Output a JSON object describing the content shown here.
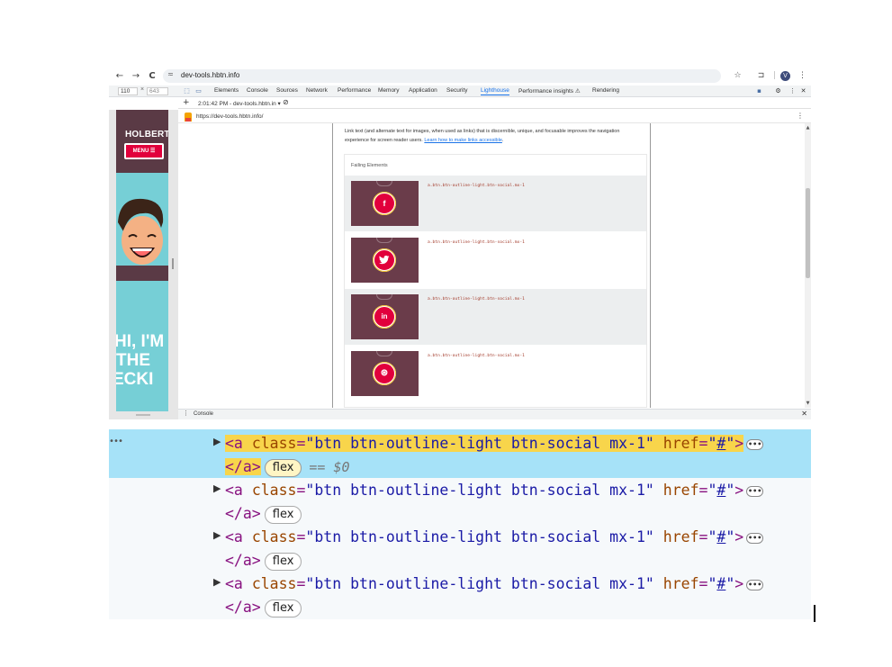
{
  "browser": {
    "url": "dev-tools.hbtn.info",
    "tune_icon": "≂",
    "back": "←",
    "forward": "→",
    "reload": "C",
    "profile_letter": "V"
  },
  "devtools": {
    "dims": {
      "width": "110",
      "x": "×",
      "height": "643"
    },
    "tabs": [
      "Elements",
      "Console",
      "Sources",
      "Network",
      "Performance",
      "Memory",
      "Application",
      "Security",
      "Lighthouse",
      "Performance insights ⚠",
      "Rendering"
    ],
    "active_tab": "Lighthouse",
    "report_select": "2:01:42 PM - dev-tools.hbtn.in ▾",
    "plus": "+",
    "report_url": "https://dev-tools.hbtn.info/",
    "drawer_label": "Console"
  },
  "preview": {
    "brand": "HOLBERT",
    "menu_label": "MENU ☰",
    "hero_lines": [
      "HI, I'M",
      "THE",
      "ECKI"
    ]
  },
  "report": {
    "description": "Link text (and alternate text for images, when used as links) that is discernible, unique, and focusable improves the navigation experience for screen reader users.",
    "learn_link": "Learn how to make links accessible",
    "failing_title": "Failing Elements",
    "items": [
      {
        "selector": "a.btn.btn-outline-light.btn-social.mx-1",
        "icon": "f",
        "icon_name": "facebook-icon"
      },
      {
        "selector": "a.btn.btn-outline-light.btn-social.mx-1",
        "icon": "🐦",
        "icon_name": "twitter-icon"
      },
      {
        "selector": "a.btn.btn-outline-light.btn-social.mx-1",
        "icon": "in",
        "icon_name": "linkedin-icon"
      },
      {
        "selector": "a.btn.btn-outline-light.btn-social.mx-1",
        "icon": "⊛",
        "icon_name": "dribbble-icon"
      }
    ]
  },
  "elements_panel": {
    "dots": "•••",
    "open_tag": "<a",
    "attr_class": "class",
    "attr_class_value": "\"btn btn-outline-light btn-social mx-1\"",
    "attr_href": "href",
    "attr_href_value": "#",
    "close_bracket": ">",
    "close_tag": "</a>",
    "pill_label": "flex",
    "more": "•••",
    "dollar0": "== $0"
  },
  "colors": {
    "selected_row": "#a6e2f8",
    "highlight": "#f8d54b",
    "brand_red": "#e1003c",
    "brand_dark": "#6a3c4a",
    "teal": "#76cfd6"
  }
}
